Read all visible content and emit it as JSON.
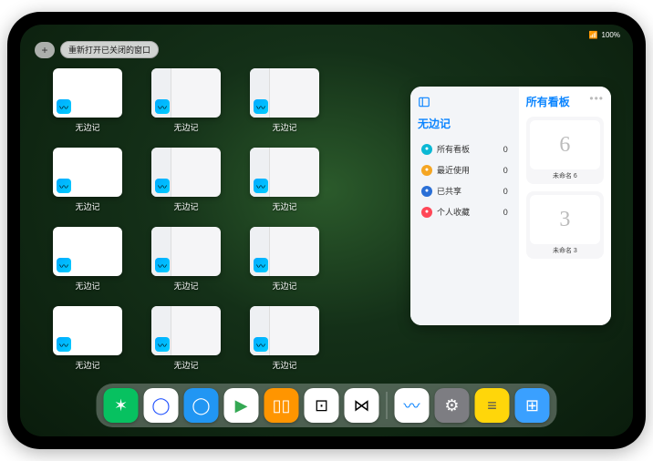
{
  "status": {
    "battery": "100%",
    "wifi": "▲"
  },
  "topControls": {
    "plus": "+",
    "reopenLabel": "重新打开已关闭的窗口"
  },
  "thumbs": {
    "appLabel": "无边记",
    "items": [
      {
        "style": "white"
      },
      {
        "style": "list"
      },
      {
        "style": "list"
      },
      {
        "style": "white"
      },
      {
        "style": "list"
      },
      {
        "style": "list"
      },
      {
        "style": "white"
      },
      {
        "style": "list"
      },
      {
        "style": "list"
      },
      {
        "style": "white"
      },
      {
        "style": "list"
      },
      {
        "style": "list"
      }
    ]
  },
  "panel": {
    "leftTitle": "无边记",
    "rightTitle": "所有看板",
    "sidebar": [
      {
        "icon": "grid",
        "color": "#0ab8d4",
        "label": "所有看板",
        "count": 0
      },
      {
        "icon": "clock",
        "color": "#f5a623",
        "label": "最近使用",
        "count": 0
      },
      {
        "icon": "share",
        "color": "#2a6fd6",
        "label": "已共享",
        "count": 0
      },
      {
        "icon": "heart",
        "color": "#ff4757",
        "label": "个人收藏",
        "count": 0
      }
    ],
    "boards": [
      {
        "glyph": "6",
        "label": "未命名 6"
      },
      {
        "glyph": "3",
        "label": "未命名 3"
      }
    ]
  },
  "dock": {
    "items": [
      {
        "name": "wechat",
        "bg": "#07c160",
        "glyph": "✶"
      },
      {
        "name": "quark",
        "bg": "#ffffff",
        "glyph": "◯",
        "fg": "#2455ff"
      },
      {
        "name": "qqbrowser",
        "bg": "#2196f3",
        "glyph": "◯"
      },
      {
        "name": "play",
        "bg": "#ffffff",
        "glyph": "▶",
        "fg": "#34a853"
      },
      {
        "name": "books",
        "bg": "#ff9500",
        "glyph": "▯▯"
      },
      {
        "name": "dice",
        "bg": "#ffffff",
        "glyph": "⊡",
        "fg": "#000"
      },
      {
        "name": "connect",
        "bg": "#ffffff",
        "glyph": "⋈",
        "fg": "#000"
      }
    ],
    "recent": [
      {
        "name": "freeform",
        "bg": "#ffffff",
        "glyph": "〰",
        "fg": "#0a84ff"
      },
      {
        "name": "settings",
        "bg": "#7d7d82",
        "glyph": "⚙"
      },
      {
        "name": "notes",
        "bg": "#ffd60a",
        "glyph": "≡",
        "fg": "#555"
      },
      {
        "name": "apps",
        "bg": "#3aa0ff",
        "glyph": "⊞"
      }
    ]
  }
}
